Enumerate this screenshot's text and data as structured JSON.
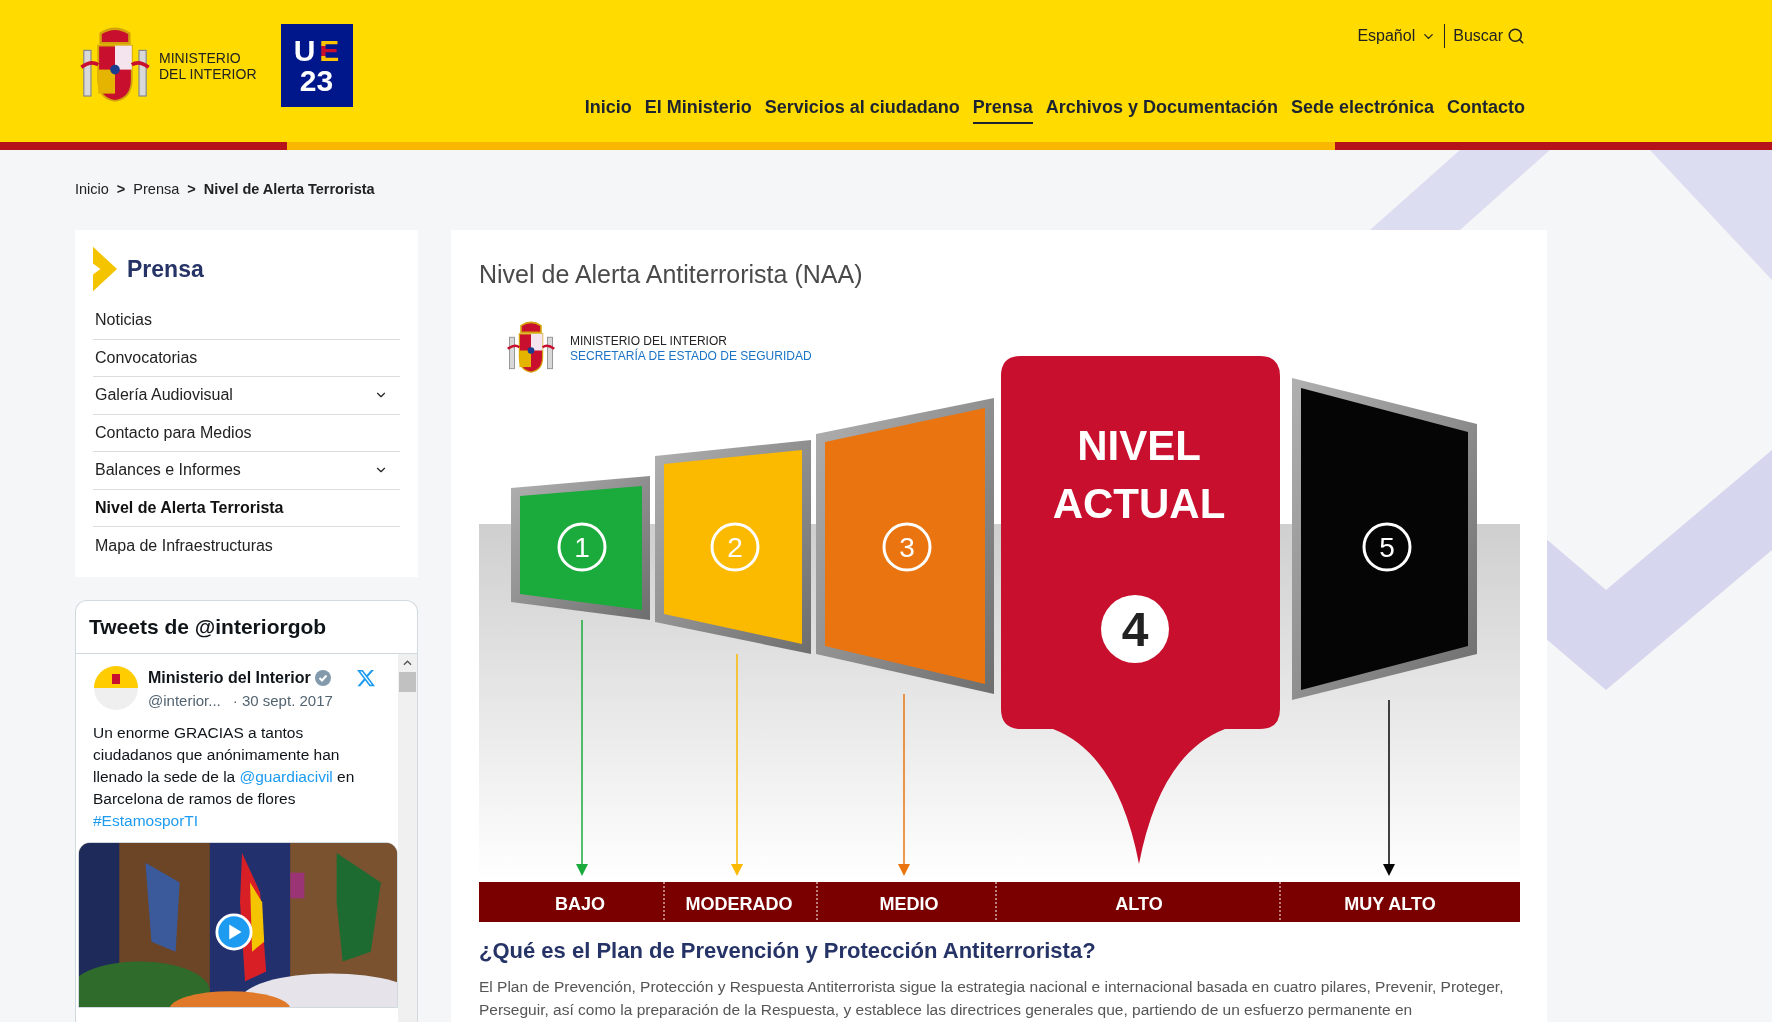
{
  "header": {
    "ministry_name": [
      "MINISTERIO",
      "DEL INTERIOR"
    ],
    "eu_badge": [
      "U",
      "E",
      "23"
    ],
    "language": "Español",
    "search": "Buscar",
    "nav": [
      {
        "label": "Inicio",
        "selected": false
      },
      {
        "label": "El Ministerio",
        "selected": false
      },
      {
        "label": "Servicios al ciudadano",
        "selected": false
      },
      {
        "label": "Prensa",
        "selected": true
      },
      {
        "label": "Archivos y Documentación",
        "selected": false
      },
      {
        "label": "Sede electrónica",
        "selected": false
      },
      {
        "label": "Contacto",
        "selected": false
      }
    ]
  },
  "breadcrumb": {
    "items": [
      "Inicio",
      "Prensa",
      "Nivel de Alerta Terrorista"
    ],
    "separator": ">"
  },
  "sidebar": {
    "title": "Prensa",
    "items": [
      {
        "label": "Noticias",
        "selected": false,
        "expandable": false
      },
      {
        "label": "Convocatorias",
        "selected": false,
        "expandable": false
      },
      {
        "label": "Galería Audiovisual",
        "selected": false,
        "expandable": true
      },
      {
        "label": "Contacto para Medios",
        "selected": false,
        "expandable": false
      },
      {
        "label": "Balances e Informes",
        "selected": false,
        "expandable": true
      },
      {
        "label": "Nivel de Alerta Terrorista",
        "selected": true,
        "expandable": false
      },
      {
        "label": "Mapa de Infraestructuras",
        "selected": false,
        "expandable": false
      }
    ]
  },
  "tweets": {
    "title": "Tweets de @interiorgob",
    "author": "Ministerio del Interior",
    "handle": "@interior...",
    "date": "· 30 sept. 2017",
    "body": [
      {
        "kind": "text",
        "text": "Un enorme GRACIAS a tantos ciudadanos que anónimamente han llenado la sede de la "
      },
      {
        "kind": "link",
        "text": "@guardiacivil"
      },
      {
        "kind": "text",
        "text": " en Barcelona de ramos de flores "
      },
      {
        "kind": "link",
        "text": "#EstamosporTI"
      }
    ]
  },
  "main": {
    "title": "Nivel de Alerta Antiterrorista (NAA)",
    "infographic": {
      "org_lines": [
        "MINISTERIO  DEL INTERIOR",
        "SECRETARÍA  DE ESTADO DE SEGURIDAD"
      ],
      "current_caption": [
        "NIVEL",
        "ACTUAL"
      ],
      "levels": [
        {
          "number": "1",
          "label": "BAJO",
          "color": "#1aab3c",
          "selected": false
        },
        {
          "number": "2",
          "label": "MODERADO",
          "color": "#fbb900",
          "selected": false
        },
        {
          "number": "3",
          "label": "MEDIO",
          "color": "#ea7410",
          "selected": false
        },
        {
          "number": "4",
          "label": "ALTO",
          "color": "#c8102e",
          "selected": true
        },
        {
          "number": "5",
          "label": "MUY ALTO",
          "color": "#050505",
          "selected": false
        }
      ]
    },
    "section_heading": "¿Qué es el Plan de Prevención y Protección Antiterrorista?",
    "paragraph": "El Plan de Prevención, Protección y Respuesta Antiterrorista sigue la estrategia nacional e internacional basada en cuatro pilares, Prevenir, Proteger, Perseguir, así como la preparación de la Respuesta, y establece las directrices generales que, partiendo de un esfuerzo permanente en"
  }
}
